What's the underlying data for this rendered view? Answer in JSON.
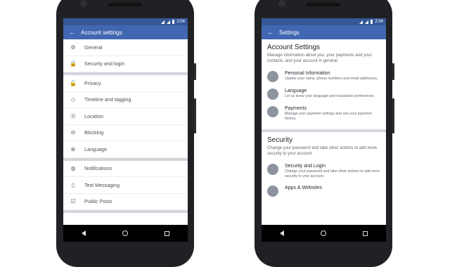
{
  "status": {
    "time": "2:04"
  },
  "left_phone": {
    "title": "Account settings",
    "items_group1": [
      {
        "label": "General",
        "icon": "gear-icon",
        "glyph": "⚙"
      },
      {
        "label": "Security and login",
        "icon": "lock-icon",
        "glyph": "🔒"
      }
    ],
    "items_group2": [
      {
        "label": "Privacy",
        "icon": "unlock-icon",
        "glyph": "🔓"
      },
      {
        "label": "Timeline and tagging",
        "icon": "tag-icon",
        "glyph": "◇"
      },
      {
        "label": "Location",
        "icon": "location-icon",
        "glyph": "Ⓐ"
      },
      {
        "label": "Blocking",
        "icon": "block-icon",
        "glyph": "⊖"
      },
      {
        "label": "Language",
        "icon": "globe-icon",
        "glyph": "⊕"
      }
    ],
    "items_group3": [
      {
        "label": "Notifications",
        "icon": "globe-notification-icon",
        "glyph": "◍"
      },
      {
        "label": "Text Messaging",
        "icon": "phone-icon",
        "glyph": "▯"
      },
      {
        "label": "Public Posts",
        "icon": "checkbox-icon",
        "glyph": "☑"
      }
    ]
  },
  "right_phone": {
    "title": "Settings",
    "account_section": {
      "heading": "Account Settings",
      "description": "Manage information about you, your payments and your contacts, and your account in general."
    },
    "account_items": [
      {
        "title": "Personal Information",
        "desc": "Update your name, phone numbers and email addresses.",
        "icon": "person-icon"
      },
      {
        "title": "Language",
        "desc": "Let us know your language and translation preferences.",
        "icon": "globe-icon"
      },
      {
        "title": "Payments",
        "desc": "Manage your payment settings and see your payment history.",
        "icon": "credit-card-icon"
      }
    ],
    "security_section": {
      "heading": "Security",
      "description": "Change your password and take other actions to add more security to your account."
    },
    "security_items": [
      {
        "title": "Security and Login",
        "desc": "Change your password and take other actions to add more security to your account.",
        "icon": "shield-icon"
      },
      {
        "title": "Apps & Websites",
        "desc": "",
        "icon": "apps-icon"
      }
    ]
  },
  "colors": {
    "appbar": "#4267b2",
    "statusbar": "#365899"
  }
}
